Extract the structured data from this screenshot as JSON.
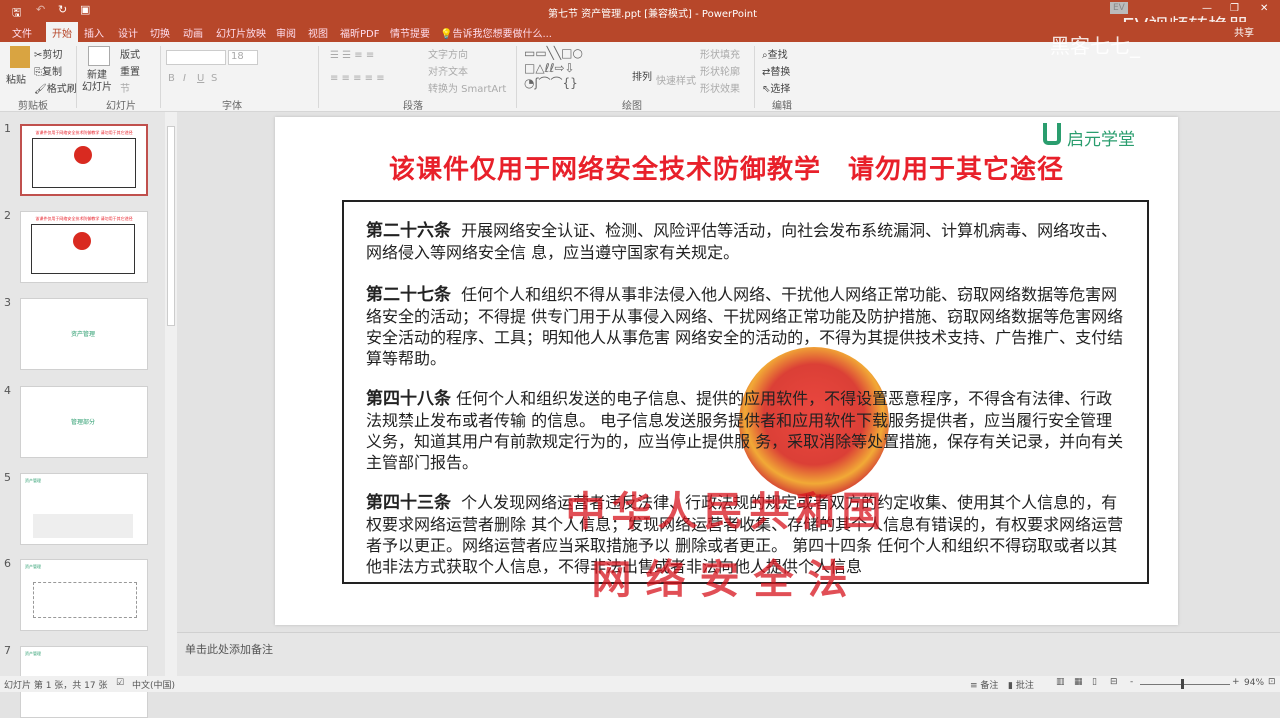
{
  "window": {
    "title": "第七节 资产管理.ppt [兼容模式] - PowerPoint",
    "share": "共享"
  },
  "watermark_overlay": {
    "app": "EV视频转换器",
    "user": "黑客七七_"
  },
  "tabs": [
    "文件",
    "开始",
    "插入",
    "设计",
    "切换",
    "动画",
    "幻灯片放映",
    "审阅",
    "视图",
    "福昕PDF",
    "情节提要"
  ],
  "tell_me": "告诉我您想要做什么...",
  "ribbon": {
    "clipboard": {
      "paste": "粘贴",
      "cut": "剪切",
      "copy": "复制",
      "format_painter": "格式刷",
      "label": "剪贴板"
    },
    "slides": {
      "new_slide": "新建\n幻灯片",
      "layout": "版式",
      "reset": "重置",
      "section": "节",
      "label": "幻灯片"
    },
    "font": {
      "size": "18",
      "label": "字体",
      "bold": "B",
      "italic": "I",
      "underline": "U",
      "shadow": "S"
    },
    "paragraph": {
      "text_direction": "文字方向",
      "align_text": "对齐文本",
      "smartart": "转换为 SmartArt",
      "label": "段落"
    },
    "drawing": {
      "arrange": "排列",
      "quick_styles": "快速样式",
      "fill": "形状填充",
      "outline": "形状轮廓",
      "effects": "形状效果",
      "label": "绘图"
    },
    "editing": {
      "find": "查找",
      "replace": "替换",
      "select": "选择",
      "label": "编辑"
    }
  },
  "thumbnails": [
    {
      "num": "1",
      "title": "该课件仅用于网络安全技术防御教学 请勿用于其它途径"
    },
    {
      "num": "2",
      "title": "该课件仅用于网络安全技术防御教学 请勿用于其它途径"
    },
    {
      "num": "3",
      "title": "资产管理"
    },
    {
      "num": "4",
      "title": "管理部分"
    },
    {
      "num": "5",
      "title": "资产管理"
    },
    {
      "num": "6",
      "title": "资产管理"
    },
    {
      "num": "7",
      "title": "资产管理"
    }
  ],
  "slide": {
    "logo": "启元学堂",
    "headline": "该课件仅用于网络安全技术防御教学　请勿用于其它途径",
    "paragraphs": [
      {
        "title": "第二十六条",
        "text": "开展网络安全认证、检测、风险评估等活动，向社会发布系统漏洞、计算机病毒、网络攻击、网络侵入等网络安全信 息，应当遵守国家有关规定。"
      },
      {
        "title": "第二十七条",
        "text": "任何个人和组织不得从事非法侵入他人网络、干扰他人网络正常功能、窃取网络数据等危害网络安全的活动；不得提 供专门用于从事侵入网络、干扰网络正常功能及防护措施、窃取网络数据等危害网络安全活动的程序、工具；明知他人从事危害 网络安全的活动的，不得为其提供技术支持、广告推广、支付结算等帮助。"
      },
      {
        "title": "第四十八条",
        "text": "任何个人和组织发送的电子信息、提供的应用软件，不得设置恶意程序，不得含有法律、行政法规禁止发布或者传输 的信息。 电子信息发送服务提供者和应用软件下载服务提供者，应当履行安全管理义务，知道其用户有前款规定行为的，应当停止提供服 务，采取消除等处置措施，保存有关记录，并向有关主管部门报告。"
      },
      {
        "title": "第四十三条",
        "text": "个人发现网络运营者违反法律、行政法规的规定或者双方的约定收集、使用其个人信息的，有权要求网络运营者删除 其个人信息；发现网络运营者收集、存储的其个人信息有错误的，有权要求网络运营者予以更正。网络运营者应当采取措施予以 删除或者更正。 第四十四条  任何个人和组织不得窃取或者以其他非法方式获取个人信息，不得非法出售或者非法向他人提供个人信息"
      }
    ],
    "watermark_line1": "中华人民共和国",
    "watermark_line2": "网络安全法"
  },
  "notes_placeholder": "单击此处添加备注",
  "status": {
    "slide_info": "幻灯片 第 1 张，共 17 张",
    "language": "中文(中国)",
    "notes": "备注",
    "comments": "批注",
    "zoom": "94%"
  },
  "colors": {
    "accent": "#b7472a",
    "headline": "#e8202a",
    "logo": "#2a9d6e"
  }
}
